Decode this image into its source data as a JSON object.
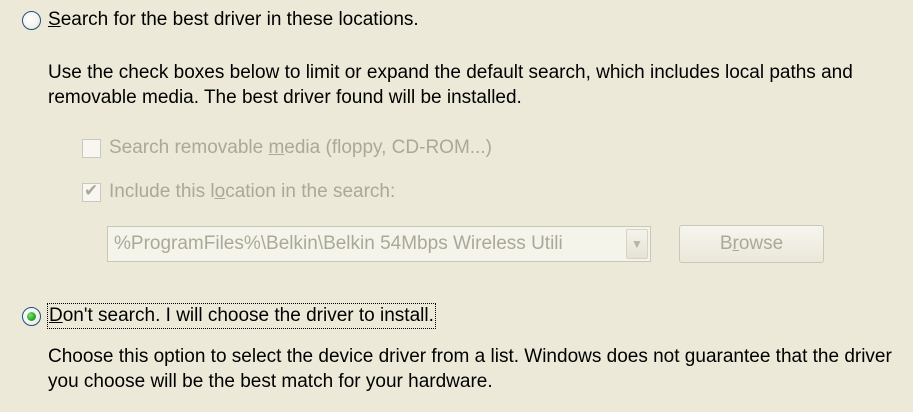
{
  "options": {
    "search": {
      "label_prefix": "",
      "label_underline": "S",
      "label_rest": "earch for the best driver in these locations.",
      "selected": false,
      "description": "Use the check boxes below to limit or expand the default search, which includes local paths and removable media. The best driver found will be installed."
    },
    "removable": {
      "label_prefix": "Search removable ",
      "label_underline": "m",
      "label_rest": "edia (floppy, CD-ROM...)",
      "checked": false,
      "enabled": false
    },
    "include_location": {
      "label_prefix": "Include this l",
      "label_underline": "o",
      "label_rest": "cation in the search:",
      "checked": true,
      "enabled": false
    },
    "location_path": {
      "value": "%ProgramFiles%\\Belkin\\Belkin 54Mbps Wireless Utili"
    },
    "browse": {
      "label_prefix": "B",
      "label_underline": "r",
      "label_rest": "owse"
    },
    "dont_search": {
      "label_prefix": "",
      "label_underline": "D",
      "label_rest": "on't search. I will choose the driver to install.",
      "selected": true,
      "description": "Choose this option to select the device driver from a list.  Windows does not guarantee that the driver you choose will be the best match for your hardware."
    }
  },
  "icons": {
    "checkmark": "✔",
    "dropdown": "▼"
  }
}
